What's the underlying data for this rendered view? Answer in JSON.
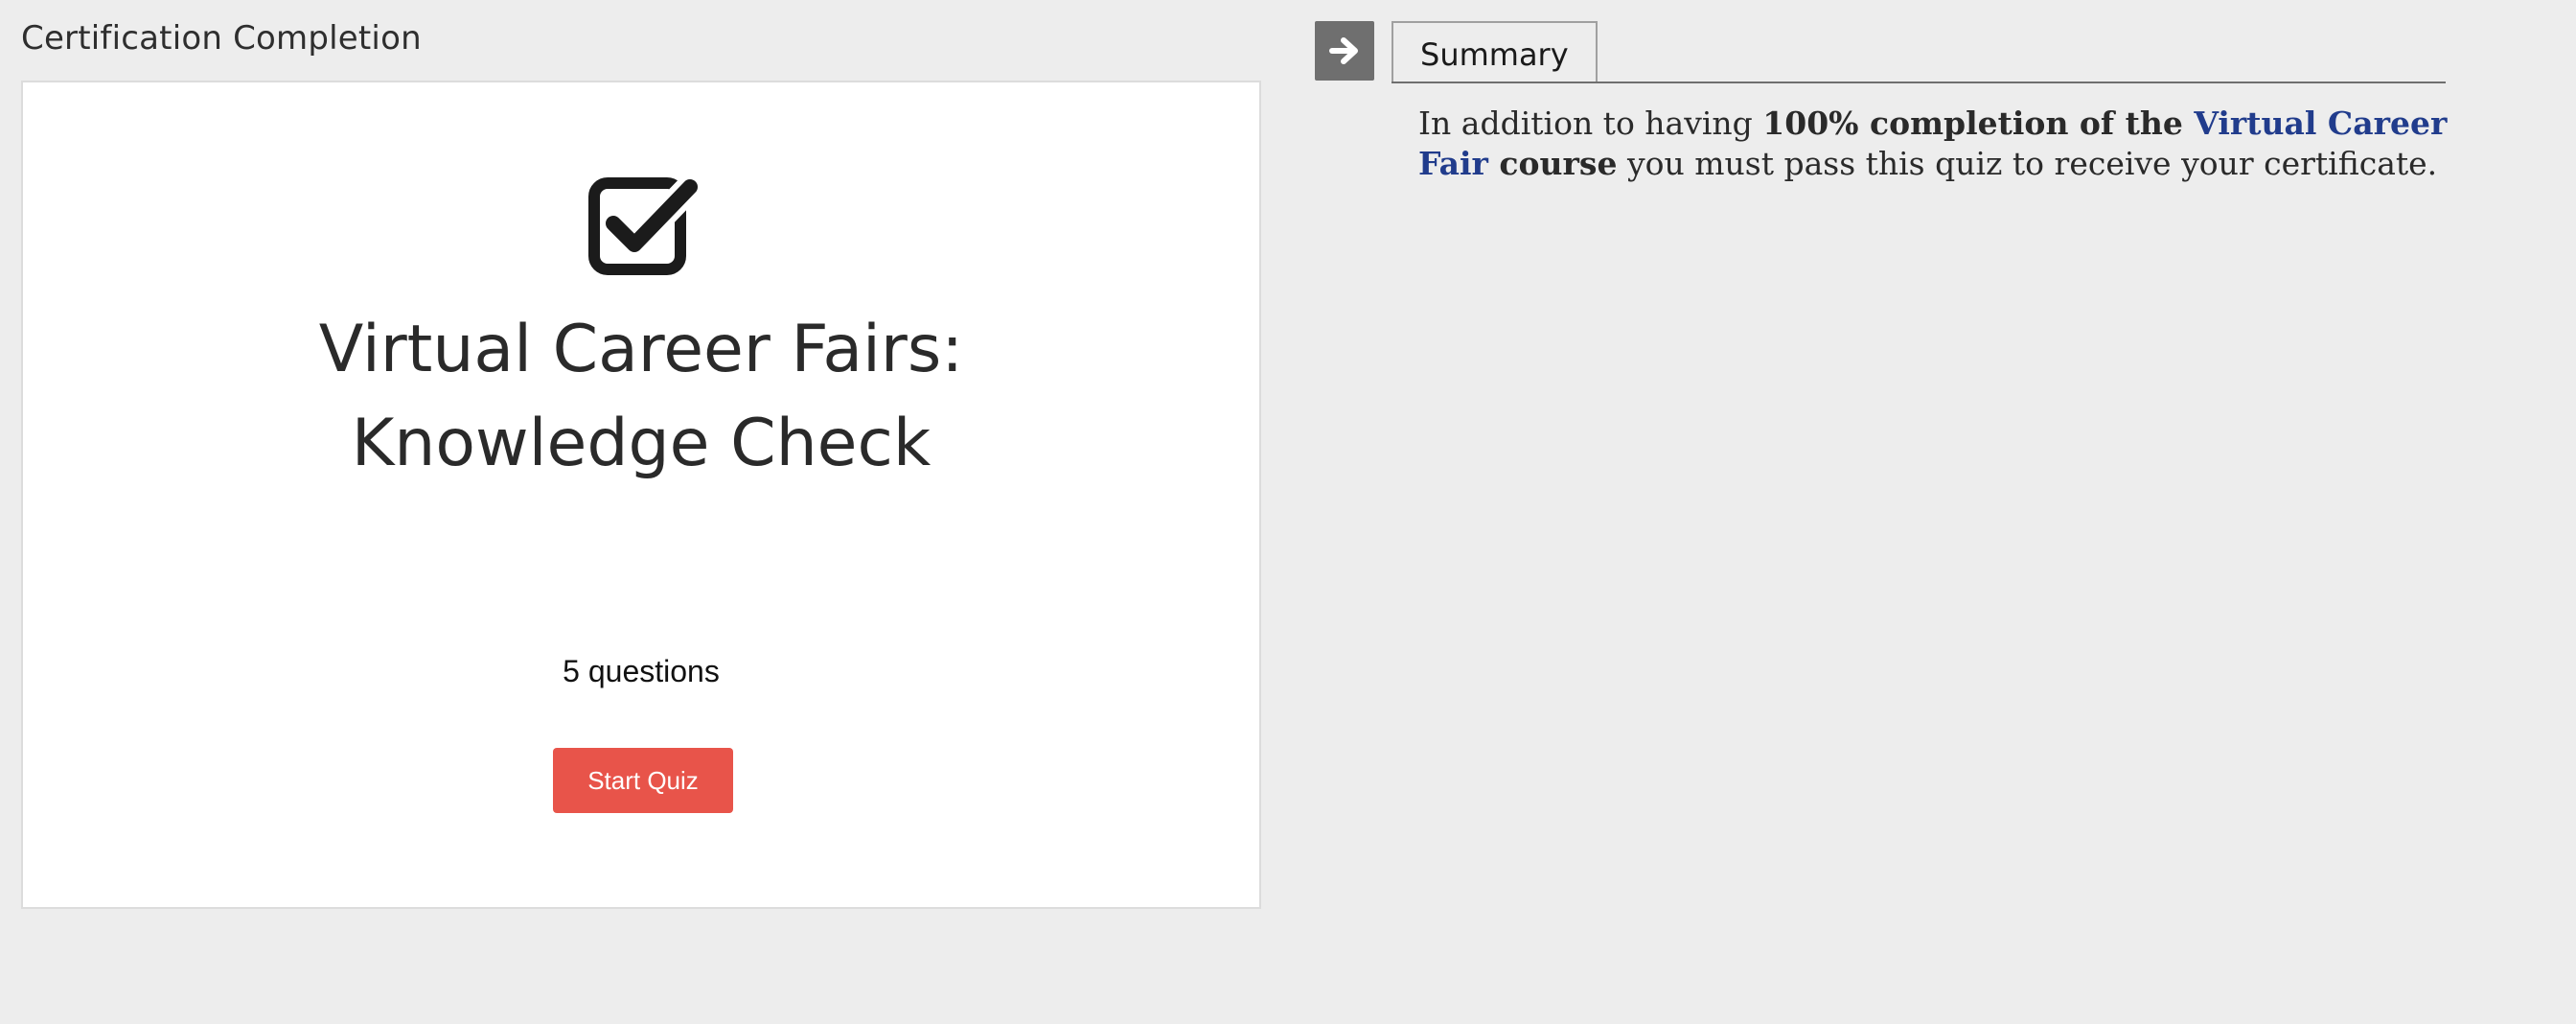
{
  "left_panel": {
    "section_title": "Certification Completion",
    "card": {
      "icon": "checkbox-check-icon",
      "title": "Virtual Career Fairs: Knowledge Check",
      "question_count": "5 questions",
      "start_button_label": "Start Quiz"
    }
  },
  "right_panel": {
    "toggle_icon": "arrow-right-icon",
    "tabs": [
      {
        "label": "Summary",
        "active": true
      }
    ],
    "summary": {
      "intro": "In addition to having ",
      "bold_part": "100% completion of the ",
      "link_text": "Virtual Career Fair",
      "bold_tail": " course",
      "ending": " you must pass this quiz to receive your certificate."
    }
  },
  "colors": {
    "background": "#ededed",
    "card": "#ffffff",
    "accent_button": "#e8544a",
    "link": "#213c8c",
    "toggle": "#6f6f6f"
  }
}
